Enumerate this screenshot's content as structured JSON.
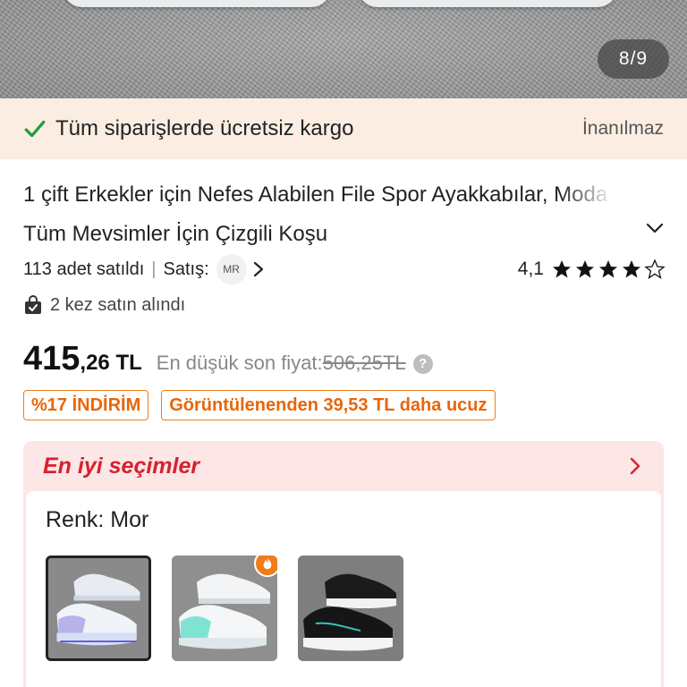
{
  "gallery": {
    "counter": "8/9"
  },
  "shipping": {
    "text": "Tüm siparişlerde ücretsiz kargo",
    "badge": "İnanılmaz"
  },
  "product": {
    "title": "1 çift Erkekler için Nefes Alabilen File Spor Ayakkabılar, Moda Tüm Mevsimler İçin Çizgili Koşu",
    "sold": "113 adet satıldı",
    "seller_label": "Satış:",
    "seller_badge": "MR",
    "rating": "4,1",
    "stars_filled": 4,
    "stars_total": 5,
    "bought_times": "2 kez satın alındı"
  },
  "price": {
    "main": "415",
    "cents": ",26 TL",
    "lowest_label": "En düşük son fiyat:",
    "old_price": "506,25TL"
  },
  "tags": {
    "discount": "%17 İNDİRİM",
    "cheaper": "Görüntülenenden 39,53 TL daha ucuz"
  },
  "best_picks": {
    "header": "En iyi seçimler",
    "color_label": "Renk: Mor",
    "swatches": [
      "Mor",
      "Mint",
      "Siyah"
    ]
  },
  "colors": {
    "accent": "#e8660a",
    "red": "#d6212f",
    "banner_bg": "#fbede2",
    "card_bg": "#fde6e6",
    "check": "#1e9d3f"
  }
}
